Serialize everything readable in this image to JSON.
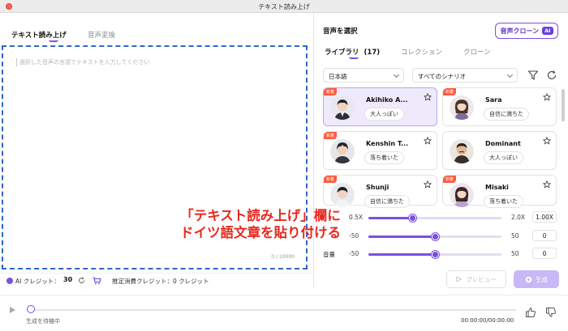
{
  "window": {
    "title": "テキスト読み上げ"
  },
  "left_tabs": {
    "tts": "テキスト読み上げ",
    "conversion": "音声変換"
  },
  "editor": {
    "placeholder": "選択した音声の言語でテキストを入力してください",
    "char_count": "0 / 10000"
  },
  "voice_panel": {
    "heading": "音声を選択",
    "clone_button": "音声クローン",
    "ai_badge": "AI",
    "tabs": {
      "library": "ライブラリ",
      "library_count": "(17)",
      "collection": "コレクション",
      "clone": "クローン"
    },
    "language": "日本語",
    "scenario": "すべてのシナリオ",
    "voices": [
      {
        "badge": "新着",
        "name": "Akihiko A...",
        "tag": "大人っぽい",
        "selected": true
      },
      {
        "badge": "新着",
        "name": "Sara",
        "tag": "自信に満ちた",
        "selected": false
      },
      {
        "badge": "新着",
        "name": "Kenshin T...",
        "tag": "落ち着いた",
        "selected": false
      },
      {
        "badge": "",
        "name": "Dominant",
        "tag": "大人っぽい",
        "selected": false
      },
      {
        "badge": "新着",
        "name": "Shunji",
        "tag": "自信に満ちた",
        "selected": false
      },
      {
        "badge": "新着",
        "name": "Misaki",
        "tag": "落ち着いた",
        "selected": false
      }
    ]
  },
  "sliders": [
    {
      "label": "",
      "min": "0.5X",
      "max": "2.0X",
      "value": "1.00X",
      "fraction": 0.33
    },
    {
      "label": "",
      "min": "-50",
      "max": "50",
      "value": "0",
      "fraction": 0.5
    },
    {
      "label": "音量",
      "min": "-50",
      "max": "50",
      "value": "0",
      "fraction": 0.5
    }
  ],
  "overlay": {
    "line1": "「テキスト読み上げ」欄に",
    "line2": "ドイツ語文章を貼り付ける"
  },
  "credits": {
    "label": "AI クレジット：",
    "value": "30",
    "estimate": "推定消費クレジット：0 クレジット"
  },
  "actions": {
    "preview": "プレビュー",
    "generate": "生成"
  },
  "player": {
    "status": "生成を待機中",
    "time": "00:00:00/00:00:00"
  },
  "colors": {
    "accent": "#7a4fe0",
    "overlay_text": "#e8281e",
    "new_badge": "#ff5a3c",
    "editor_border": "#2f66c8"
  }
}
